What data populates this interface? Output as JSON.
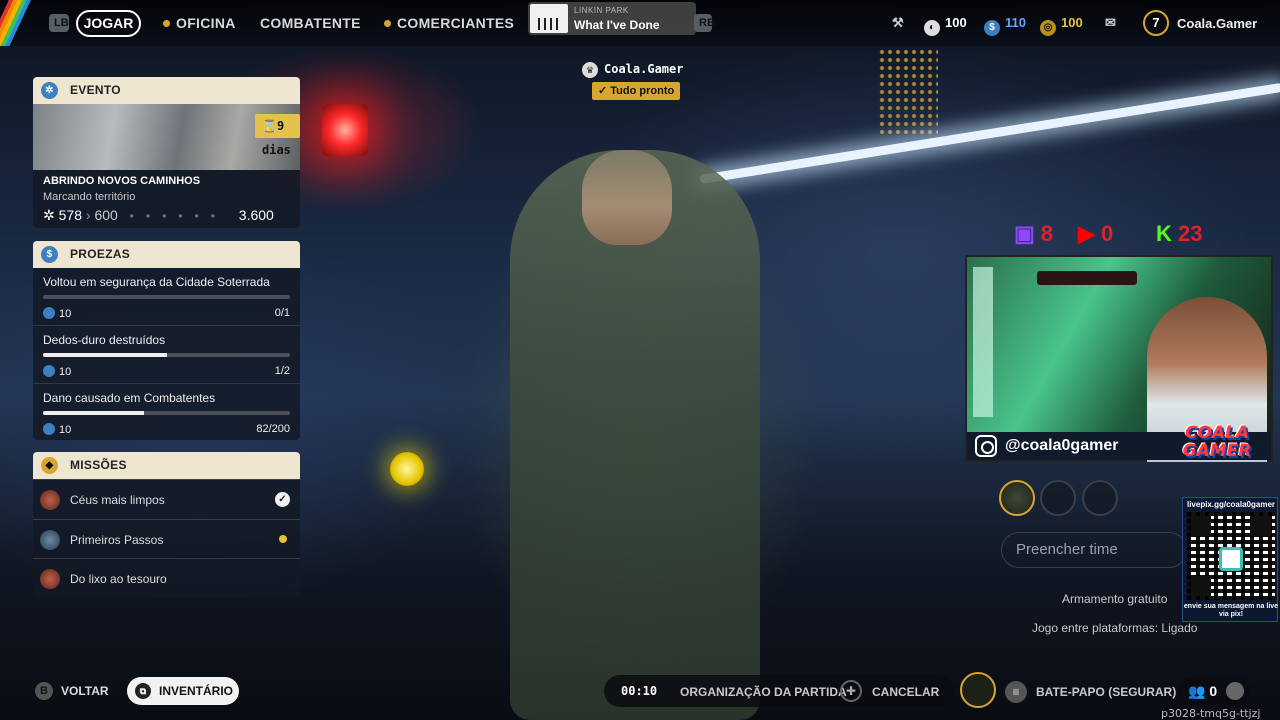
{
  "topbar": {
    "lb": "LB",
    "rb": "RB",
    "tabs": [
      {
        "label": "JOGAR",
        "active": true
      },
      {
        "label": "OFICINA"
      },
      {
        "label": "COMBATENTE"
      },
      {
        "label": "COMERCIANTES"
      }
    ],
    "now_playing": {
      "artist": "LINKIN PARK",
      "track": "What I've Done"
    },
    "currencies": [
      {
        "icon": "raider-token-icon",
        "value": "100"
      },
      {
        "icon": "blue-coin-icon",
        "value": "110"
      },
      {
        "icon": "gold-coin-icon",
        "value": "100"
      }
    ],
    "level": "7",
    "username": "Coala.Gamer"
  },
  "player_tag": {
    "name": "Coala.Gamer",
    "status": "Tudo pronto"
  },
  "event": {
    "header": "EVENTO",
    "days": "9 dias",
    "title": "ABRINDO NOVOS CAMINHOS",
    "subtitle": "Marcando território",
    "progress": "578",
    "next": "600",
    "goal": "3.600"
  },
  "feats": {
    "header": "PROEZAS",
    "items": [
      {
        "name": "Voltou em segurança da Cidade Soterrada",
        "reward": "10",
        "count": "0/1",
        "progress": 0.0
      },
      {
        "name": "Dedos-duro destruídos",
        "reward": "10",
        "count": "1/2",
        "progress": 0.5
      },
      {
        "name": "Dano causado em Combatentes",
        "reward": "10",
        "count": "82/200",
        "progress": 0.41
      }
    ]
  },
  "missions": {
    "header": "MISSÕES",
    "items": [
      {
        "label": "Céus mais limpos",
        "status": "done"
      },
      {
        "label": "Primeiros Passos",
        "status": "active"
      },
      {
        "label": "Do lixo ao tesouro",
        "status": "none"
      }
    ]
  },
  "stream_overlay": {
    "twitch": "8",
    "youtube": "0",
    "kick": "23",
    "instagram": "@coala0gamer",
    "logo_top": "COALA",
    "logo_bottom": "GAMER",
    "pix_url": "livepix.gg/coala0gamer",
    "pix_msg": "envie sua mensagem na live via pix!"
  },
  "squad": {
    "fill_placeholder": "Preencher time",
    "free_loadout": "Armamento gratuito",
    "crossplay": "Jogo entre plataformas: Ligado"
  },
  "bottom": {
    "b_btn": "B",
    "back": "VOLTAR",
    "inventory": "INVENTÁRIO",
    "timer": "00:10",
    "matchmaking": "ORGANIZAÇÃO DA PARTIDA",
    "cancel": "CANCELAR",
    "chat": "BATE-PAPO (SEGURAR)",
    "party_count": "0",
    "session_id": "p3028-tmq5g-ttjzj"
  },
  "colors": {
    "accent": "#d9a531",
    "panel_header": "#efe6d2",
    "twitch": "#9146ff",
    "youtube": "#ff0000",
    "kick": "#53fc18"
  }
}
